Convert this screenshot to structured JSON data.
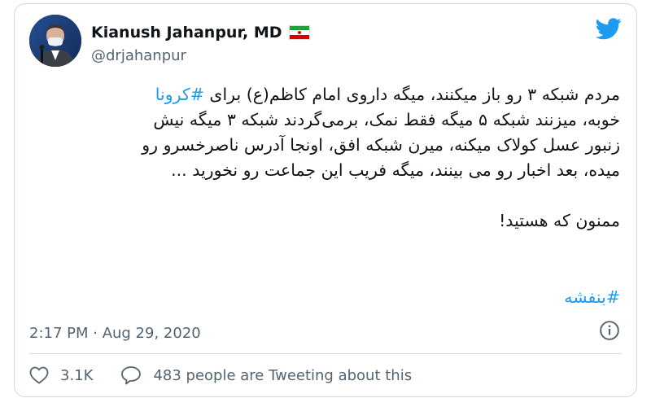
{
  "author": {
    "name": "Kianush Jahanpur, MD",
    "handle": "@drjahanpur",
    "flag_icon": "iran-flag-icon",
    "avatar_icon": "profile-photo"
  },
  "brand": {
    "icon": "twitter-bird-icon",
    "color": "#1d9bf0"
  },
  "tweet": {
    "line1_prefix": "مردم شبکه ۳ رو باز میکنند، میگه داروی امام کاظم(ع) برای ",
    "line1_hashtag": "#کرونا",
    "line2": "خوبه، میزنند شبکه ۵ میگه فقط نمک، برمی‌گردند شبکه ۳ میگه نیش",
    "line3": "زنبور عسل کولاک میکنه، میرن شبکه افق، اونجا آدرس ناصرخسرو رو",
    "line4": "میده،  بعد اخبار رو می بینند، میگه فریب این جماعت رو نخورید ...",
    "thanks": "ممنون که هستید!",
    "hashtag2": "#بنفشه"
  },
  "meta": {
    "timestamp": "2:17 PM · Aug 29, 2020",
    "info_icon": "info-icon"
  },
  "actions": {
    "likes": "3.1K",
    "replies_text": "483 people are Tweeting about this"
  }
}
